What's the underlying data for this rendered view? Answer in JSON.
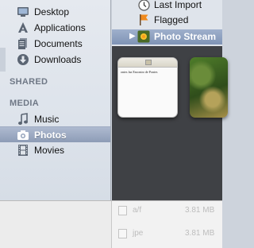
{
  "finder_sidebar": {
    "places": [
      {
        "label": "Desktop",
        "icon": "desktop-icon"
      },
      {
        "label": "Applications",
        "icon": "applications-icon"
      },
      {
        "label": "Documents",
        "icon": "documents-icon"
      },
      {
        "label": "Downloads",
        "icon": "downloads-icon"
      }
    ],
    "shared_header": "SHARED",
    "media_header": "MEDIA",
    "media": [
      {
        "label": "Music",
        "icon": "music-icon",
        "selected": false
      },
      {
        "label": "Photos",
        "icon": "camera-icon",
        "selected": true
      },
      {
        "label": "Movies",
        "icon": "film-icon",
        "selected": false
      }
    ]
  },
  "iphoto_sidebar": {
    "items": [
      {
        "label": "Last Import",
        "icon": "clock-icon"
      },
      {
        "label": "Flagged",
        "icon": "flag-icon"
      },
      {
        "label": "Photo Stream",
        "icon": "photo-stream-icon",
        "selected": true
      }
    ]
  },
  "photos": {
    "thumb1_caption": "ontes faz Encontro de Pontes"
  },
  "background_list": {
    "rows": [
      {
        "name": "a/f",
        "size": "3.81 MB"
      },
      {
        "name": "jpe",
        "size": "3.81 MB"
      }
    ]
  },
  "colors": {
    "selection": "#8d9cb6",
    "photo_bg": "#3f4145",
    "sidebar_bg": "#dde3eb"
  }
}
